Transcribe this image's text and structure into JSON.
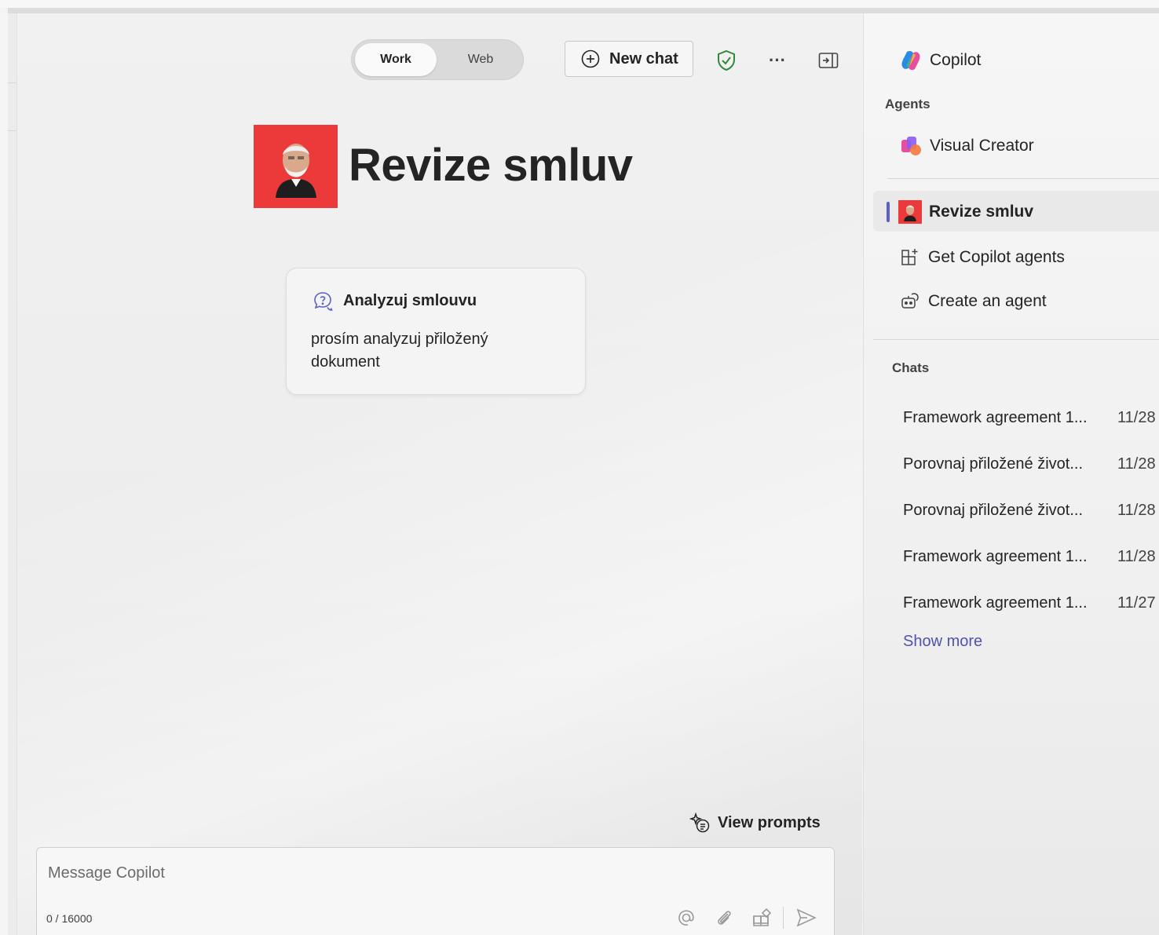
{
  "mode_toggle": {
    "work": "Work",
    "web": "Web"
  },
  "toolbar": {
    "new_chat": "New chat",
    "more": "···"
  },
  "agent": {
    "title": "Revize smluv"
  },
  "prompt_card": {
    "title": "Analyzuj smlouvu",
    "body": "prosím analyzuj přiložený dokument"
  },
  "view_prompts": "View prompts",
  "composer": {
    "placeholder": "Message Copilot",
    "counter": "0 / 16000"
  },
  "sidebar": {
    "app_name": "Copilot",
    "agents_header": "Agents",
    "agents": [
      {
        "label": "Visual Creator"
      },
      {
        "label": "Revize smluv"
      }
    ],
    "get_agents": "Get Copilot agents",
    "create_agent": "Create an agent",
    "chats_header": "Chats",
    "chats": [
      {
        "title": "Framework agreement 1...",
        "date": "11/28"
      },
      {
        "title": "Porovnaj přiložené život...",
        "date": "11/28"
      },
      {
        "title": "Porovnaj přiložené život...",
        "date": "11/28"
      },
      {
        "title": "Framework agreement 1...",
        "date": "11/28"
      },
      {
        "title": "Framework agreement 1...",
        "date": "11/27"
      }
    ],
    "show_more": "Show more"
  },
  "colors": {
    "accent": "#5b5fc7",
    "link": "#4f52b2",
    "agent_red": "#ec3a3a",
    "shield_green": "#2e8b3a"
  }
}
